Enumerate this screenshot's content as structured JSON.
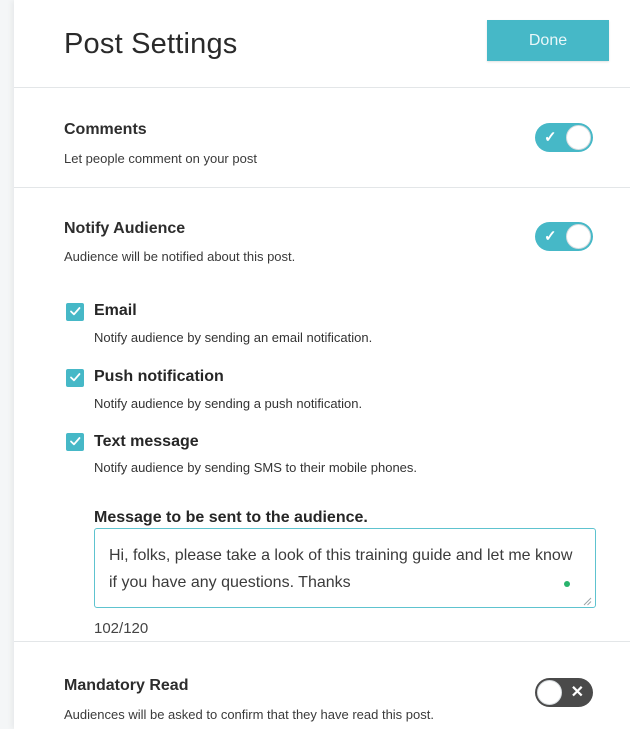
{
  "header": {
    "title": "Post Settings",
    "done_label": "Done"
  },
  "comments": {
    "title": "Comments",
    "description": "Let people comment on your post",
    "enabled": true,
    "toggle_mark": "✓"
  },
  "notify": {
    "title": "Notify Audience",
    "description": "Audience will be notified about this post.",
    "enabled": true,
    "toggle_mark": "✓",
    "options": [
      {
        "label": "Email",
        "description": "Notify audience by sending an email notification.",
        "checked": true
      },
      {
        "label": "Push notification",
        "description": "Notify audience by sending a push notification.",
        "checked": true
      },
      {
        "label": "Text message",
        "description": "Notify audience by sending SMS to their mobile phones.",
        "checked": true
      }
    ],
    "message": {
      "label": "Message to be sent to the audience.",
      "value": "Hi, folks, please take a look of this training guide and let me know if you have any questions. Thanks",
      "counter": "102/120"
    }
  },
  "mandatory": {
    "title": "Mandatory Read",
    "description": "Audiences will be asked to confirm that they have read this post.",
    "enabled": false,
    "toggle_mark": "✕"
  },
  "colors": {
    "accent": "#46b8c7",
    "toggle_off": "#4a4a4a",
    "status_dot": "#29b36c"
  }
}
